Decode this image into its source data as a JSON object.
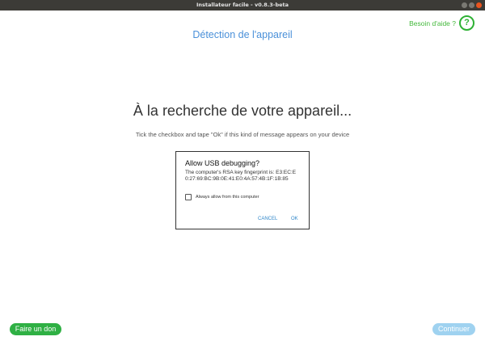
{
  "window": {
    "title": "Installateur facile - v0.8.3-beta",
    "controls": [
      "minimize-icon",
      "maximize-icon",
      "close-icon"
    ]
  },
  "header": {
    "help_label": "Besoin d'aide ?",
    "help_icon_text": "?",
    "heading": "Détection de l'appareil"
  },
  "main": {
    "status": "À la recherche de votre appareil...",
    "hint": "Tick the checkbox and tape \"Ok\" if this kind of message appears on your device"
  },
  "dialog": {
    "title": "Allow USB debugging?",
    "body": "The computer's RSA key fingerprint is: E3:EC:E0:27:69:BC:9B:0E:41:E0:4A:57:4B:1F:1B:85",
    "checkbox_label": "Always allow from this computer",
    "checkbox_checked": false,
    "cancel_label": "CANCEL",
    "ok_label": "OK"
  },
  "footer": {
    "donate_label": "Faire un don",
    "continue_label": "Continuer",
    "continue_enabled": false
  },
  "colors": {
    "accent_green": "#2fb044",
    "accent_blue": "#4a90d9",
    "disabled_blue": "#9fd2f0",
    "titlebar": "#3c3b37",
    "close_button": "#e9541f"
  }
}
